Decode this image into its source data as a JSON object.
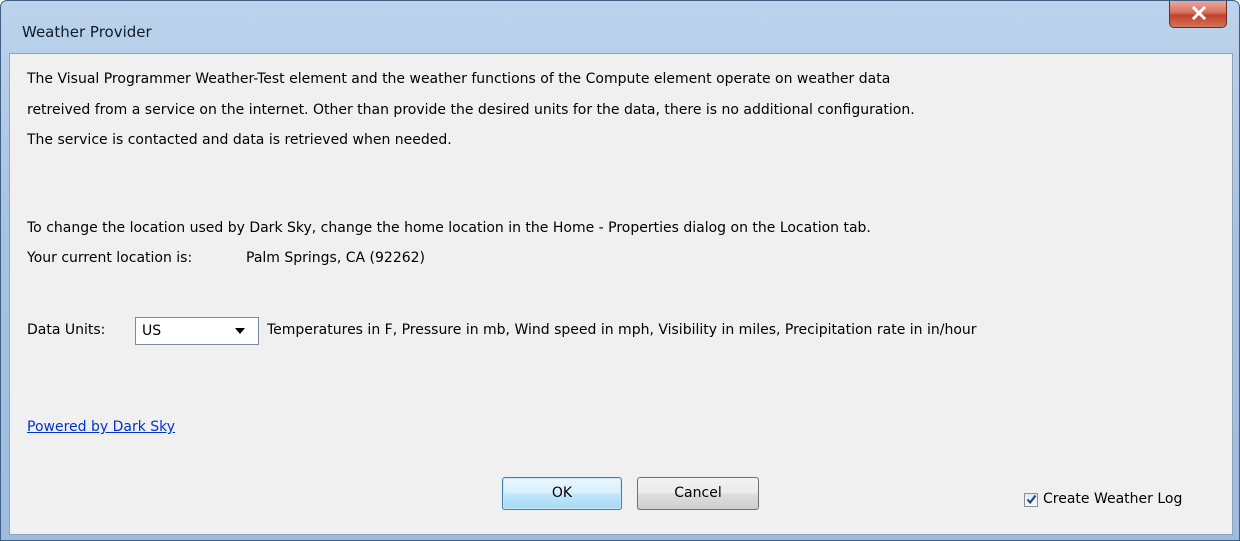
{
  "window": {
    "title": "Weather Provider",
    "close_symbol": "x"
  },
  "body": {
    "paragraph_lines": [
      "The Visual Programmer Weather-Test element and the weather functions of the Compute element operate on weather data",
      "retreived from a service on the internet. Other than provide the desired units for the data, there is no additional configuration.",
      "The service is contacted and data is retrieved when needed."
    ],
    "location_line": "To change the location used by Dark Sky, change the home location in the Home - Properties dialog on the Location tab.",
    "current_location_label": "Your current location is:",
    "current_location_value": "Palm Springs, CA (92262)",
    "units_label": "Data Units:",
    "units_selected": "US",
    "units_description": "Temperatures in F, Pressure in mb, Wind speed in mph, Visibility in miles, Precipitation rate in in/hour",
    "powered_link": "Powered by Dark Sky"
  },
  "buttons": {
    "ok": "OK",
    "cancel": "Cancel"
  },
  "log_option": {
    "label": "Create Weather Log",
    "checked": true
  },
  "icons": {
    "close": "close-icon",
    "dropdown": "chevron-down-icon",
    "checkmark": "checkmark-icon"
  }
}
